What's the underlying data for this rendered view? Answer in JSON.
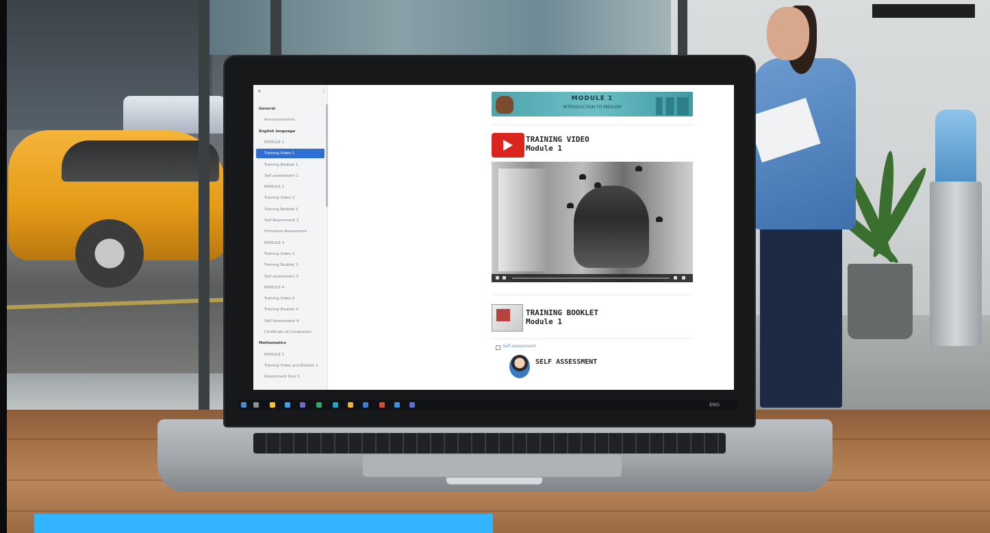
{
  "sidebar": {
    "close_glyph": "×",
    "menu_glyph": "⋮",
    "items": [
      {
        "label": "General",
        "kind": "section"
      },
      {
        "label": "Announcements",
        "kind": "item"
      },
      {
        "label": "English language",
        "kind": "section"
      },
      {
        "label": "MODULE 1",
        "kind": "item"
      },
      {
        "label": "Training Video 1",
        "kind": "active"
      },
      {
        "label": "Training Booklet 1",
        "kind": "item"
      },
      {
        "label": "Self assessment 1",
        "kind": "item"
      },
      {
        "label": "MODULE 2",
        "kind": "item"
      },
      {
        "label": "Training Video 2",
        "kind": "item"
      },
      {
        "label": "Training Booklet 2",
        "kind": "item"
      },
      {
        "label": "Self Assessment 2",
        "kind": "item"
      },
      {
        "label": "Formative Assessment",
        "kind": "item"
      },
      {
        "label": "MODULE 3",
        "kind": "item"
      },
      {
        "label": "Training Video 3",
        "kind": "item"
      },
      {
        "label": "Training Booklet 3",
        "kind": "item"
      },
      {
        "label": "Self assessment 3",
        "kind": "item"
      },
      {
        "label": "MODULE 4",
        "kind": "item"
      },
      {
        "label": "Training Video 4",
        "kind": "item"
      },
      {
        "label": "Training Booklet 4",
        "kind": "item"
      },
      {
        "label": "Self Assessment 4",
        "kind": "item"
      },
      {
        "label": "Certificate of Completion",
        "kind": "item"
      },
      {
        "label": "Mathematics",
        "kind": "section"
      },
      {
        "label": "MODULE 1",
        "kind": "item"
      },
      {
        "label": "Training Video and Booklet 1",
        "kind": "item"
      },
      {
        "label": "Assessment Quiz 1",
        "kind": "item"
      }
    ]
  },
  "banner": {
    "title": "MODULE 1",
    "subtitle": "INTRODUCTION TO ENGLISH"
  },
  "video_section": {
    "title_line1": "TRAINING VIDEO",
    "title_line2": "Module 1",
    "icon": "play-icon"
  },
  "booklet_section": {
    "title_line1": "TRAINING BOOKLET",
    "title_line2": "Module 1",
    "icon": "booklet-icon"
  },
  "self_assessment": {
    "tag": "Self assessment",
    "title": "SELF ASSESSMENT",
    "icon": "graduate-avatar-icon"
  },
  "taskbar": {
    "right_text": "ENG"
  },
  "colors": {
    "active_item": "#2f6fd1",
    "banner": "#4fa3ad",
    "youtube_red": "#d9251d",
    "caption_bar": "#33b4ff"
  }
}
